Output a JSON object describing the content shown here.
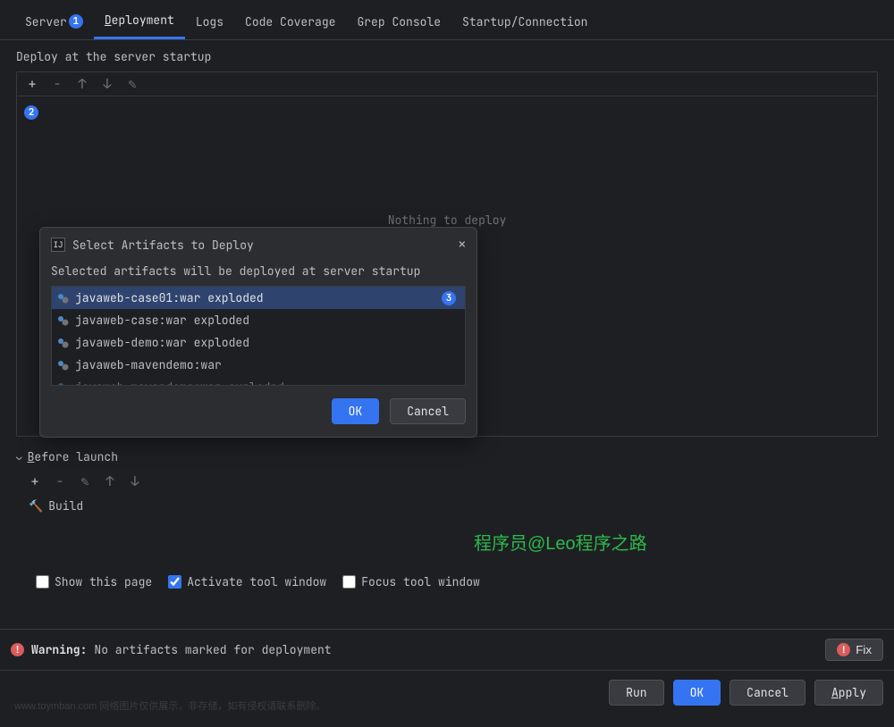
{
  "tabs": {
    "server": "Server",
    "deployment": "Deployment",
    "logs": "Logs",
    "coverage": "Code Coverage",
    "grep": "Grep Console",
    "startup": "Startup/Connection"
  },
  "markers": {
    "m1": "1",
    "m2": "2",
    "m3": "3"
  },
  "section": {
    "deploy_title": "Deploy at the server startup",
    "placeholder": "Nothing to deploy",
    "before_launch": "Before launch",
    "build": "Build"
  },
  "checkboxes": {
    "show_page": "Show this page",
    "activate": "Activate tool window",
    "focus": "Focus tool window"
  },
  "warning": {
    "label": "Warning:",
    "text": "No artifacts marked for deployment",
    "fix": "Fix"
  },
  "buttons": {
    "run": "Run",
    "ok": "OK",
    "cancel": "Cancel",
    "apply": "Apply"
  },
  "dialog": {
    "title": "Select Artifacts to Deploy",
    "subtitle": "Selected artifacts will be deployed at server startup",
    "items": [
      "javaweb-case01:war exploded",
      "javaweb-case:war exploded",
      "javaweb-demo:war exploded",
      "javaweb-mavendemo:war",
      "javaweb-mavendemo:war exploded"
    ],
    "ok": "OK",
    "cancel": "Cancel"
  },
  "watermark": "程序员@Leo程序之路",
  "disclaimer": "www.toymban.com 网络图片仅供展示，非存储，如有侵权请联系删除。"
}
